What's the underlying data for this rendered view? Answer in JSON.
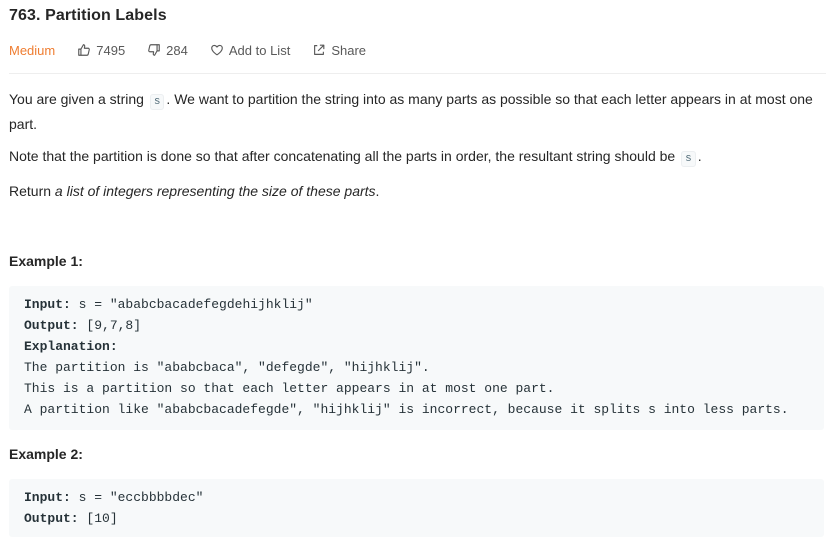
{
  "problem": {
    "title": "763. Partition Labels",
    "difficulty": "Medium",
    "likes": "7495",
    "dislikes": "284",
    "add_to_list": "Add to List",
    "share": "Share"
  },
  "description": {
    "p1_a": "You are given a string",
    "p1_code": "s",
    "p1_b": ". We want to partition the string into as many parts as possible so that each letter appears in at most one part.",
    "p2_a": "Note that the partition is done so that after concatenating all the parts in order, the resultant string should be",
    "p2_code": "s",
    "p2_b": ".",
    "p3_a": "Return",
    "p3_em": "a list of integers representing the size of these parts",
    "p3_b": "."
  },
  "example1": {
    "heading": "Example 1:",
    "input_label": "Input:",
    "input_value": " s = \"ababcbacadefegdehijhklij\"",
    "output_label": "Output:",
    "output_value": " [9,7,8]",
    "explanation_label": "Explanation:",
    "lines": [
      "The partition is \"ababcbaca\", \"defegde\", \"hijhklij\".",
      "This is a partition so that each letter appears in at most one part.",
      "A partition like \"ababcbacadefegde\", \"hijhklij\" is incorrect, because it splits s into less parts."
    ]
  },
  "example2": {
    "heading": "Example 2:",
    "input_label": "Input:",
    "input_value": " s = \"eccbbbbdec\"",
    "output_label": "Output:",
    "output_value": " [10]"
  },
  "colors": {
    "difficulty_medium": "#ef7d31",
    "text": "#262626",
    "muted": "#595959",
    "code_bg": "#f7f9fa"
  },
  "icons": [
    "thumbs-up-icon",
    "thumbs-down-icon",
    "heart-icon",
    "share-icon"
  ]
}
